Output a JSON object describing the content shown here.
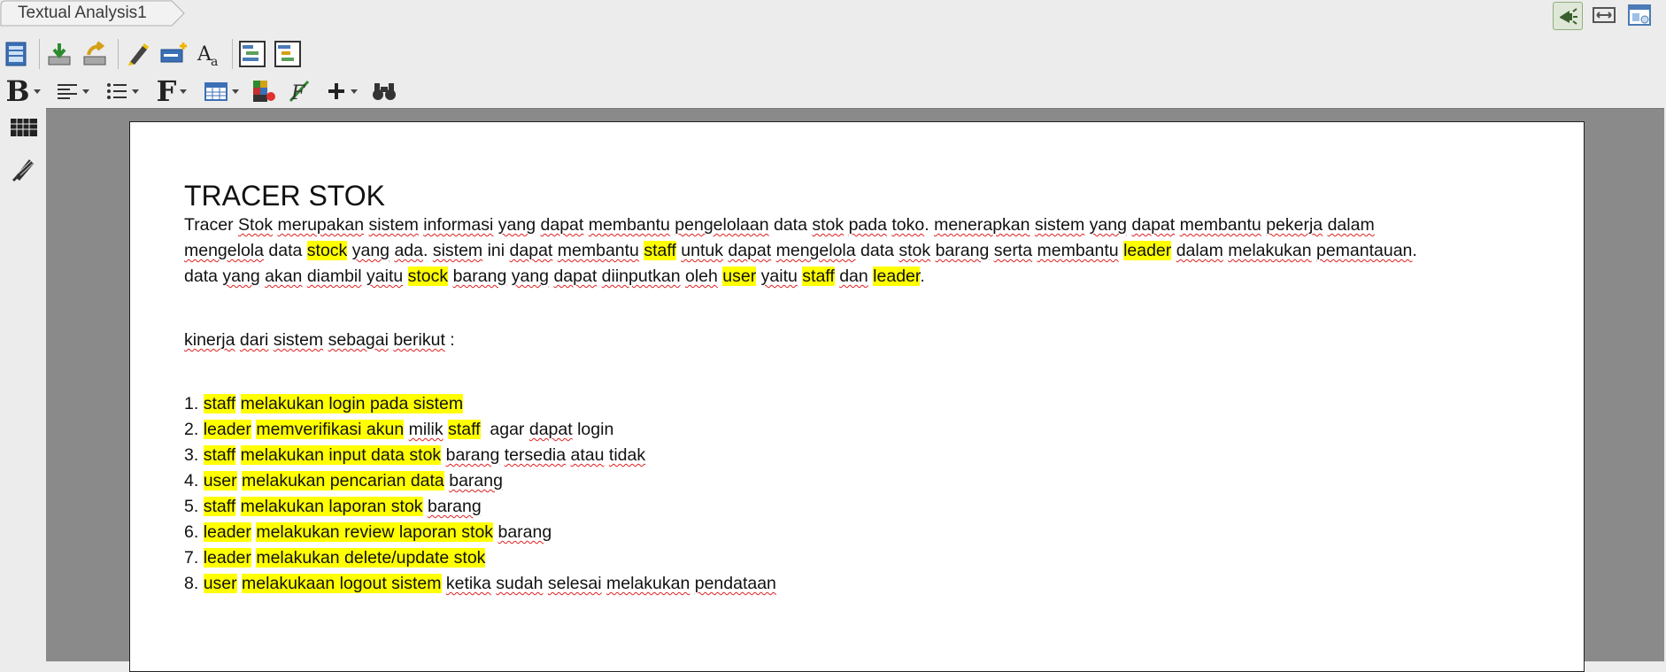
{
  "tab": {
    "title": "Textual Analysis1"
  },
  "document": {
    "title": "TRACER STOK",
    "paragraph_lines": [
      "Tracer Stok merupakan sistem informasi yang dapat membantu pengelolaan data stok pada toko. menerapkan sistem yang dapat membantu pekerja dalam",
      "mengelola data stock yang ada. sistem ini dapat membantu staff untuk dapat mengelola data stok barang serta membantu leader dalam melakukan pemantauan.",
      "data yang akan diambil yaitu stock barang yang dapat diinputkan oleh user yaitu staff dan leader."
    ],
    "intro": "kinerja dari sistem sebagai berikut :",
    "items": [
      {
        "num": "1.",
        "actor": "staff",
        "hl_text": "melakukan login pada sistem",
        "rest": ""
      },
      {
        "num": "2.",
        "actor": "leader",
        "hl_text": "memverifikasi akun",
        "rest": " milik ",
        "actor2": "staff",
        "rest2": "  agar dapat login"
      },
      {
        "num": "3.",
        "actor": "staff",
        "hl_text": "melakukan input data stok",
        "rest": " barang tersedia atau tidak"
      },
      {
        "num": "4.",
        "actor": "user",
        "hl_text": "melakukan pencarian data",
        "rest": " barang"
      },
      {
        "num": "5.",
        "actor": "staff",
        "hl_text": "melakukan laporan stok",
        "rest": " barang"
      },
      {
        "num": "6.",
        "actor": "leader",
        "hl_text": "melakukan review laporan stok",
        "rest": " barang"
      },
      {
        "num": "7.",
        "actor": "leader",
        "hl_text": "melakukan delete/update stok",
        "rest": ""
      },
      {
        "num": "8.",
        "actor": "user",
        "hl_text": "melakukaan logout sistem",
        "rest": " ketika sudah selesai melakukan pendataan"
      }
    ]
  },
  "toolbar": {
    "row1_icons": [
      "new-document-icon",
      "import-icon",
      "export-icon",
      "highlighter-icon",
      "new-field-icon",
      "text-style-icon",
      "layout-view-icon",
      "structure-view-icon"
    ],
    "row2_icons": [
      "bold-icon",
      "align-icon",
      "list-icon",
      "font-icon",
      "table-icon",
      "color-icon",
      "formula-icon",
      "add-icon",
      "find-icon"
    ]
  },
  "colors": {
    "highlight": "#ffff00",
    "squiggle": "#e02020",
    "canvas": "#8a8a8a"
  }
}
